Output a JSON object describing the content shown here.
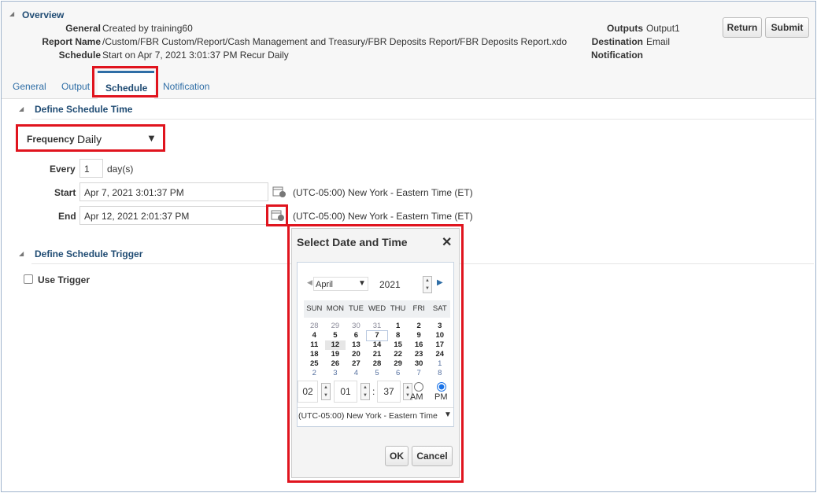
{
  "overview": {
    "title": "Overview",
    "general_label": "General",
    "general_value": "Created by training60",
    "report_label": "Report Name",
    "report_value": "/Custom/FBR Custom/Report/Cash Management and Treasury/FBR Deposits Report/FBR Deposits Report.xdo",
    "schedule_label": "Schedule",
    "schedule_value": "Start on Apr 7, 2021 3:01:37 PM Recur Daily",
    "outputs_label": "Outputs",
    "outputs_value": "Output1",
    "destination_label": "Destination",
    "destination_value": "Email",
    "notification_label": "Notification"
  },
  "buttons": {
    "return": "Return",
    "submit": "Submit"
  },
  "tabs": [
    {
      "label": "General"
    },
    {
      "label": "Output"
    },
    {
      "label": "Schedule",
      "active": true
    },
    {
      "label": "Notification"
    }
  ],
  "schedule_time": {
    "title": "Define Schedule Time",
    "frequency_label": "Frequency",
    "frequency_value": "Daily",
    "every_label": "Every",
    "every_value": "1",
    "every_unit": "day(s)",
    "start_label": "Start",
    "start_value": "Apr 7, 2021 3:01:37 PM",
    "start_tz": "(UTC-05:00) New York - Eastern Time (ET)",
    "end_label": "End",
    "end_value": "Apr 12, 2021 2:01:37 PM",
    "end_tz": "(UTC-05:00) New York - Eastern Time (ET)"
  },
  "trigger": {
    "title": "Define Schedule Trigger",
    "use_trigger_label": "Use Trigger",
    "use_trigger_checked": false
  },
  "dialog": {
    "title": "Select Date and Time",
    "month": "April",
    "year": "2021",
    "days_of_week": [
      "SUN",
      "MON",
      "TUE",
      "WED",
      "THU",
      "FRI",
      "SAT"
    ],
    "weeks": [
      [
        "28",
        "29",
        "30",
        "31",
        "1",
        "2",
        "3"
      ],
      [
        "4",
        "5",
        "6",
        "7",
        "8",
        "9",
        "10"
      ],
      [
        "11",
        "12",
        "13",
        "14",
        "15",
        "16",
        "17"
      ],
      [
        "18",
        "19",
        "20",
        "21",
        "22",
        "23",
        "24"
      ],
      [
        "25",
        "26",
        "27",
        "28",
        "29",
        "30",
        "1"
      ],
      [
        "2",
        "3",
        "4",
        "5",
        "6",
        "7",
        "8"
      ]
    ],
    "selected_day": "12",
    "today": "7",
    "hour": "02",
    "minute": "01",
    "second": "37",
    "am_label": "AM",
    "pm_label": "PM",
    "ampm": "PM",
    "timezone": "(UTC-05:00) New York - Eastern Time",
    "ok": "OK",
    "cancel": "Cancel"
  },
  "colors": {
    "highlight": "#e0141e",
    "link": "#2f6ea6",
    "header": "#1f4b73"
  }
}
